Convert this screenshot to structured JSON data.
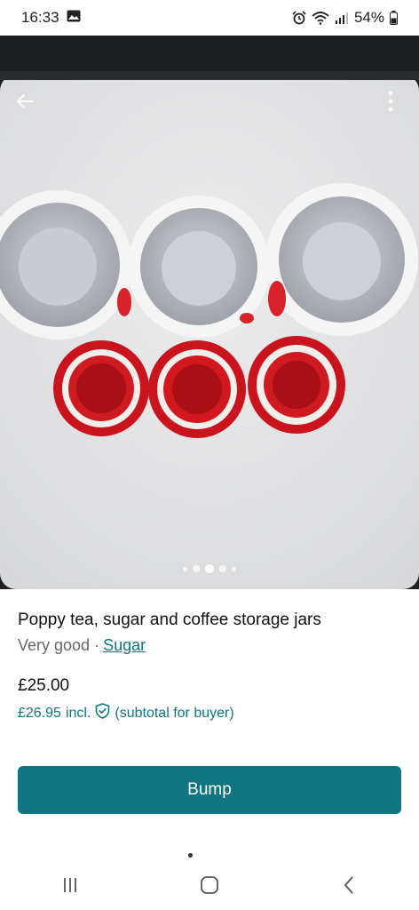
{
  "status_bar": {
    "time": "16:33",
    "battery": "54%",
    "icons": [
      "gallery-icon",
      "alarm-icon",
      "wifi-icon",
      "signal-icon",
      "battery-icon"
    ]
  },
  "photo": {
    "carousel": {
      "count": 5,
      "active_index": 2
    }
  },
  "listing": {
    "title": "Poppy tea, sugar and coffee storage jars",
    "condition": "Very good ·",
    "brand": "Sugar",
    "price": "£25.00",
    "price_incl": "£26.95",
    "incl_label": "incl.",
    "subtotal_label": "(subtotal for buyer)"
  },
  "actions": {
    "bump_label": "Bump"
  },
  "colors": {
    "accent": "#0f7681",
    "link": "#0e7680"
  }
}
